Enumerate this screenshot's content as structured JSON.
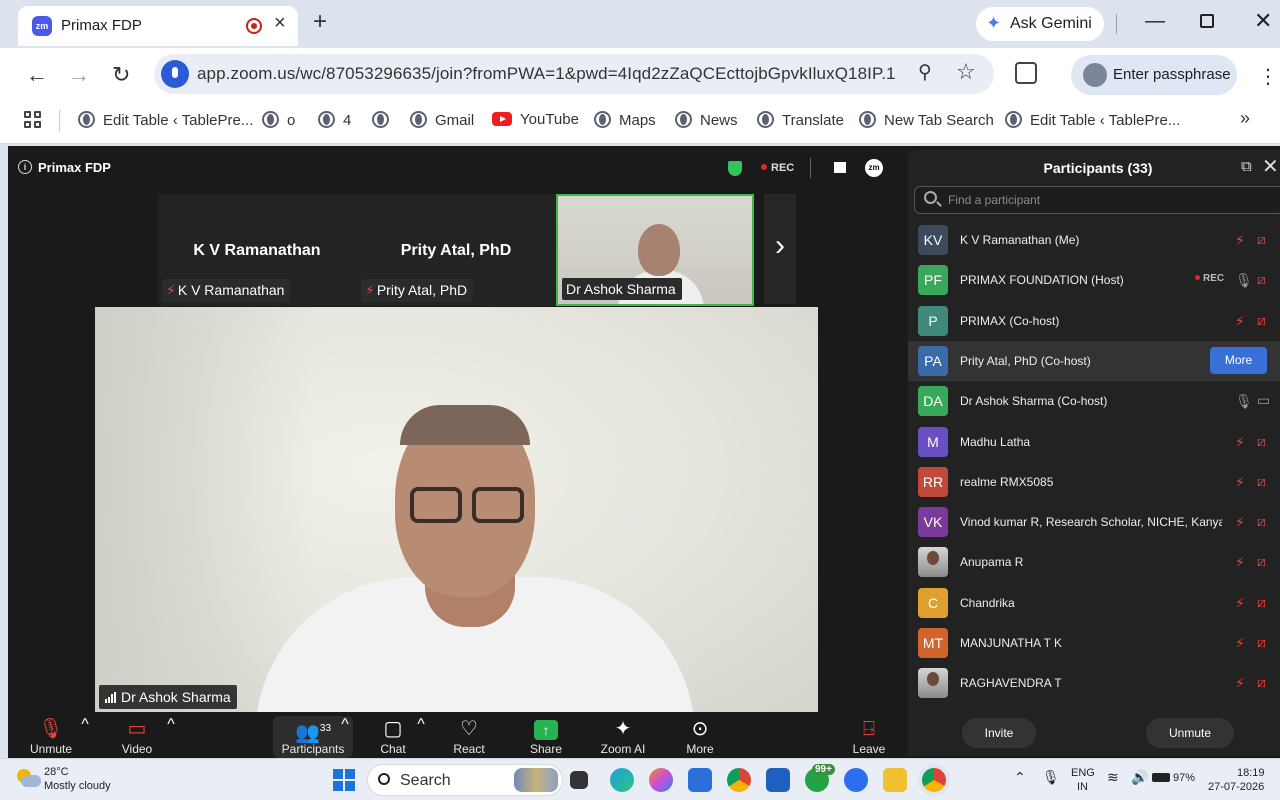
{
  "browser": {
    "tab_title": "Primax FDP",
    "tab_icon": "zm",
    "gemini_label": "Ask Gemini",
    "url": "app.zoom.us/wc/87053296635/join?fromPWA=1&pwd=4Iqd2zZaQCEcttojbGpvkIluxQ18IP.1",
    "profile_label": "Enter passphrase",
    "bookmarks": [
      {
        "label": "Edit Table ‹ TablePre...",
        "icon": "globe-icon"
      },
      {
        "label": "o",
        "icon": "globe-icon"
      },
      {
        "label": "4",
        "icon": "globe-icon"
      },
      {
        "label": "",
        "icon": "globe-icon"
      },
      {
        "label": "Gmail",
        "icon": "globe-icon"
      },
      {
        "label": "YouTube",
        "icon": "youtube-icon"
      },
      {
        "label": "Maps",
        "icon": "globe-icon"
      },
      {
        "label": "News",
        "icon": "globe-icon"
      },
      {
        "label": "Translate",
        "icon": "globe-icon"
      },
      {
        "label": "New Tab Search",
        "icon": "globe-icon"
      },
      {
        "label": "Edit Table ‹ TablePre...",
        "icon": "globe-icon"
      }
    ]
  },
  "meeting": {
    "title": "Primax FDP",
    "rec_label": "REC",
    "zoom_logo": "zm",
    "thumbnails": [
      {
        "big_name": "K V Ramanathan",
        "tag": "K V Ramanathan",
        "muted": true
      },
      {
        "big_name": "Prity Atal, PhD",
        "tag": "Prity Atal, PhD",
        "muted": true
      },
      {
        "big_name": "",
        "tag": "Dr Ashok Sharma",
        "muted": false
      }
    ],
    "speaker_name": "Dr Ashok Sharma",
    "toolbar": {
      "unmute": "Unmute",
      "video": "Video",
      "participants": "Participants",
      "participants_count": "33",
      "chat": "Chat",
      "react": "React",
      "share": "Share",
      "zoom_ai": "Zoom AI",
      "more": "More",
      "leave": "Leave"
    }
  },
  "panel": {
    "title": "Participants (33)",
    "search_placeholder": "Find a participant",
    "more_label": "More",
    "rec_label": "REC",
    "invite_label": "Invite",
    "unmute_label": "Unmute",
    "participants": [
      {
        "initials": "KV",
        "color": "#3c4a5c",
        "name": "K V Ramanathan (Me)",
        "mic": "muted",
        "cam": "off"
      },
      {
        "initials": "PF",
        "color": "#3aa85a",
        "name": "PRIMAX FOUNDATION (Host)",
        "mic": "on",
        "cam": "off",
        "rec": true
      },
      {
        "initials": "P",
        "color": "#3f8a7a",
        "name": "PRIMAX (Co-host)",
        "mic": "muted",
        "cam": "off"
      },
      {
        "initials": "PA",
        "color": "#3b6aa8",
        "name": "Prity Atal, PhD (Co-host)",
        "highlight": true
      },
      {
        "initials": "DA",
        "color": "#3aa85a",
        "name": "Dr Ashok Sharma (Co-host)",
        "mic": "on",
        "cam": "on"
      },
      {
        "initials": "M",
        "color": "#6a4fc0",
        "name": "Madhu Latha",
        "mic": "muted",
        "cam": "off"
      },
      {
        "initials": "RR",
        "color": "#c04a3a",
        "name": "realme RMX5085",
        "mic": "muted",
        "cam": "off"
      },
      {
        "initials": "VK",
        "color": "#7a3a9a",
        "name": "Vinod kumar R, Research Scholar, NICHE, Kanyak...",
        "mic": "muted",
        "cam": "off"
      },
      {
        "initials": "",
        "color": "photo",
        "name": "Anupama R",
        "mic": "muted",
        "cam": "off"
      },
      {
        "initials": "C",
        "color": "#e0a030",
        "name": "Chandrika",
        "mic": "muted",
        "cam": "off"
      },
      {
        "initials": "MT",
        "color": "#d0642a",
        "name": "MANJUNATHA T K",
        "mic": "muted",
        "cam": "off"
      },
      {
        "initials": "",
        "color": "photo",
        "name": "RAGHAVENDRA T",
        "mic": "muted",
        "cam": "off"
      }
    ]
  },
  "taskbar": {
    "temp": "28°C",
    "weather": "Mostly cloudy",
    "search_label": "Search",
    "badge": "99+",
    "lang_top": "ENG",
    "lang_bottom": "IN",
    "battery": "97%",
    "time": "18:19",
    "date": "27-07-2026"
  }
}
